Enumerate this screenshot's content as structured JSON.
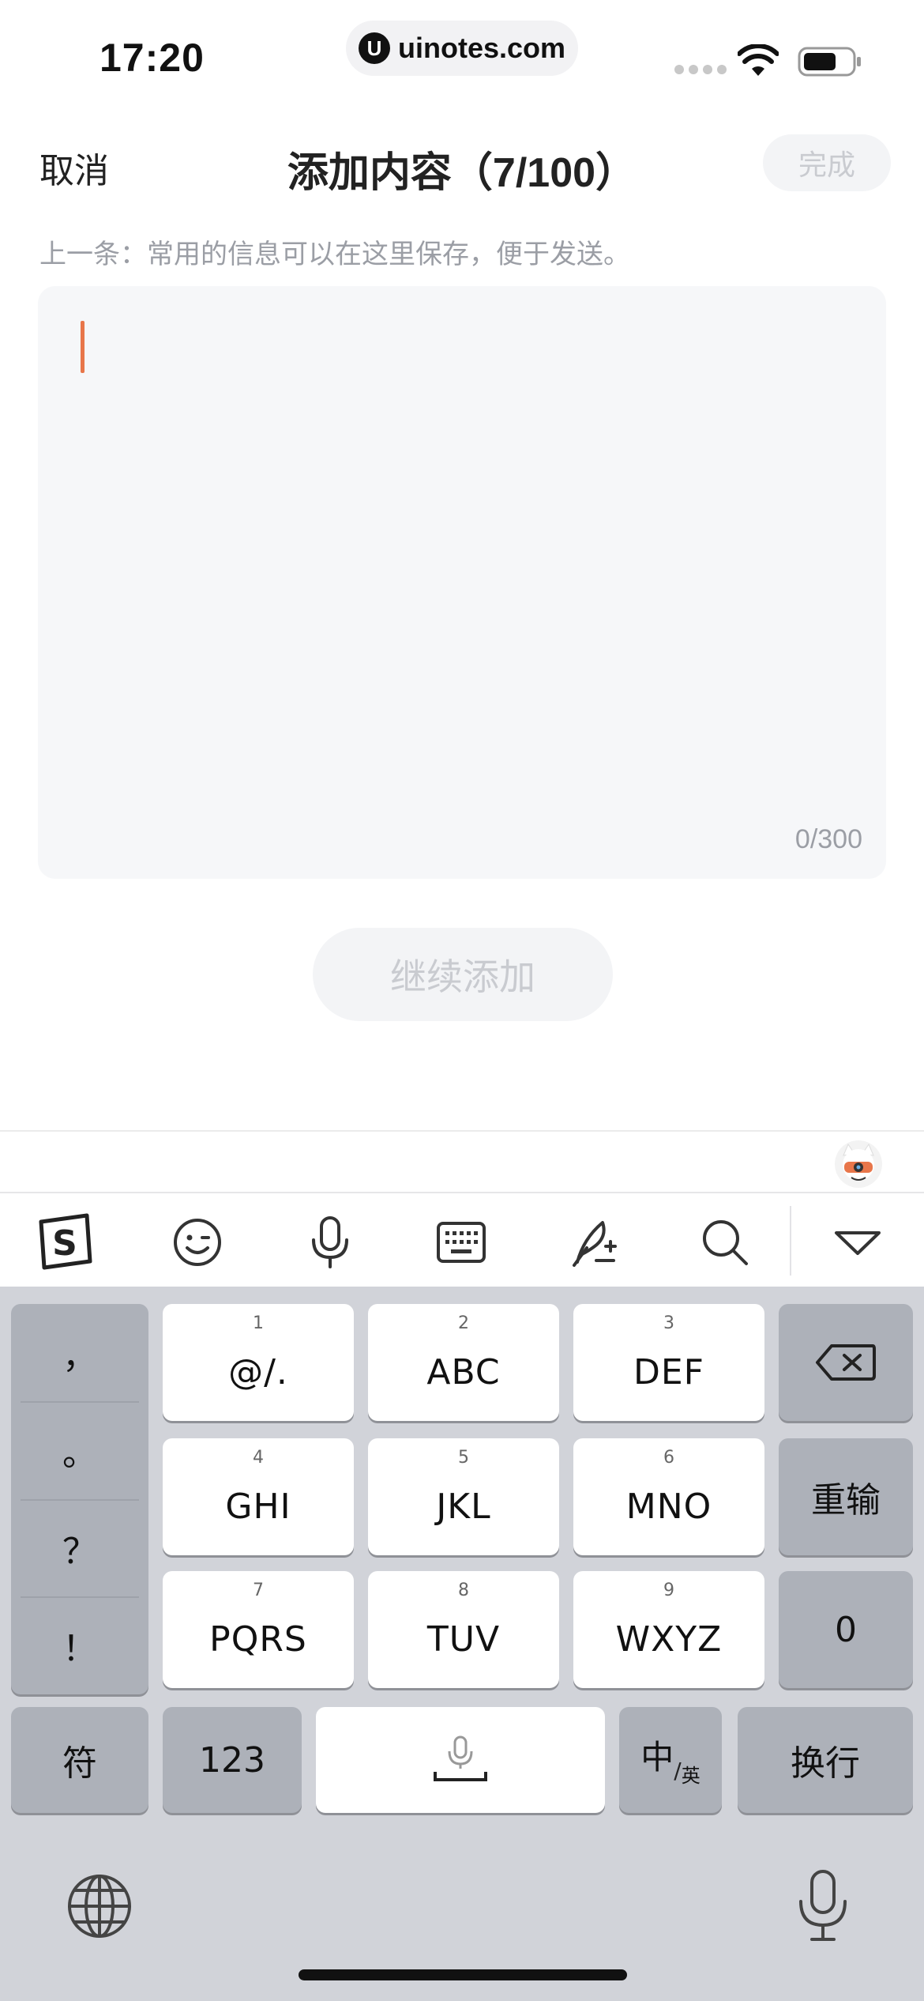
{
  "status_bar": {
    "time": "17:20",
    "url": "uinotes.com",
    "url_logo": "U"
  },
  "nav": {
    "cancel": "取消",
    "title": "添加内容（7/100）",
    "done": "完成"
  },
  "hint": "上一条：常用的信息可以在这里保存，便于发送。",
  "editor": {
    "value": "",
    "counter": "0/300"
  },
  "continue_button": "继续添加",
  "toolbar": {
    "icons": [
      "sogou-logo-icon",
      "emoji-icon",
      "voice-icon",
      "keyboard-icon",
      "handwriting-icon",
      "search-icon",
      "collapse-icon"
    ]
  },
  "keyboard": {
    "punctuation": [
      "，",
      "。",
      "？",
      "！"
    ],
    "keys": [
      {
        "num": "1",
        "label": "@/."
      },
      {
        "num": "2",
        "label": "ABC"
      },
      {
        "num": "3",
        "label": "DEF"
      },
      {
        "num": "4",
        "label": "GHI"
      },
      {
        "num": "5",
        "label": "JKL"
      },
      {
        "num": "6",
        "label": "MNO"
      },
      {
        "num": "7",
        "label": "PQRS"
      },
      {
        "num": "8",
        "label": "TUV"
      },
      {
        "num": "9",
        "label": "WXYZ"
      }
    ],
    "retype": "重输",
    "zero": "0",
    "symbols": "符",
    "numbers": "123",
    "lang_main": "中",
    "lang_sub": "英",
    "enter": "换行"
  }
}
